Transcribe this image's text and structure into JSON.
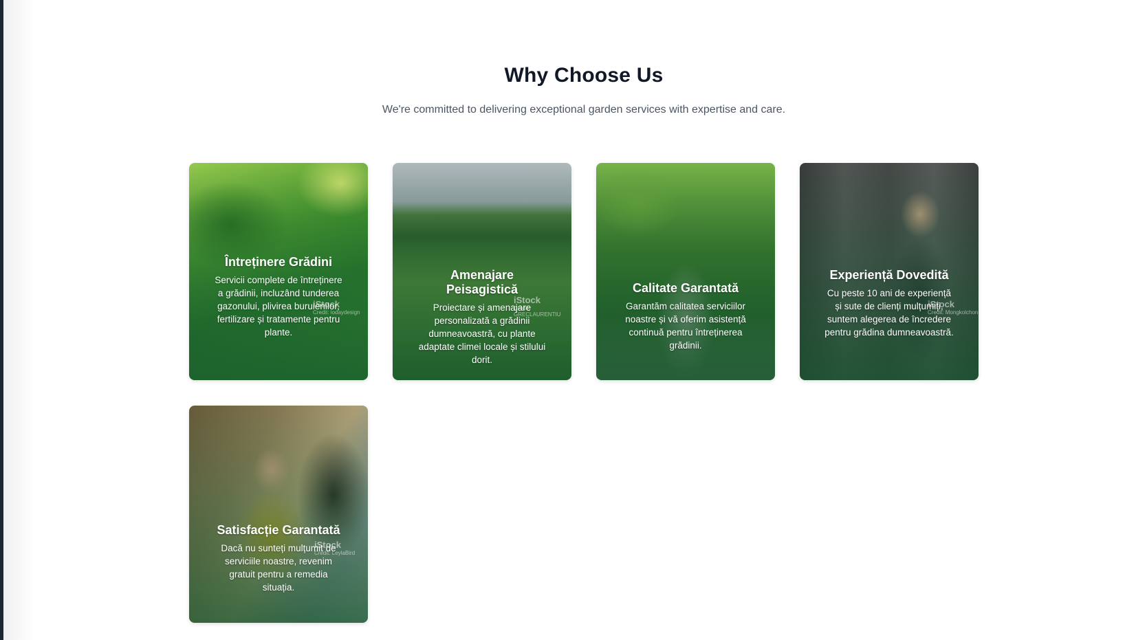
{
  "section": {
    "title": "Why Choose Us",
    "subtitle": "We're committed to delivering exceptional garden services with expertise and care."
  },
  "cards": [
    {
      "title": "Întreținere Grădini",
      "description": "Servicii complete de întreținere a grădinii, incluzând tunderea gazonului, plivirea buruienilor, fertilizare și tratamente pentru plante.",
      "watermark": "iStock",
      "credit": "Credit: lodaydesign"
    },
    {
      "title": "Amenajare Peisagistică",
      "description": "Proiectare și amenajare personalizată a grădinii dumneavoastră, cu plante adaptate climei locale și stilului dorit.",
      "watermark": "iStock",
      "credit": "Credit: GRECLAURENTIU"
    },
    {
      "title": "Calitate Garantată",
      "description": "Garantăm calitatea serviciilor noastre și vă oferim asistență continuă pentru întreținerea grădinii.",
      "watermark": "",
      "credit": ""
    },
    {
      "title": "Experiență Dovedită",
      "description": "Cu peste 10 ani de experiență și sute de clienți mulțumiți, suntem alegerea de încredere pentru grădina dumneavoastră.",
      "watermark": "iStock",
      "credit": "Credit: Mongkolchon"
    },
    {
      "title": "Satisfacție Garantată",
      "description": "Dacă nu sunteți mulțumit de serviciile noastre, revenim gratuit pentru a remedia situația.",
      "watermark": "iStock",
      "credit": "Credit: LeylaBird"
    }
  ]
}
